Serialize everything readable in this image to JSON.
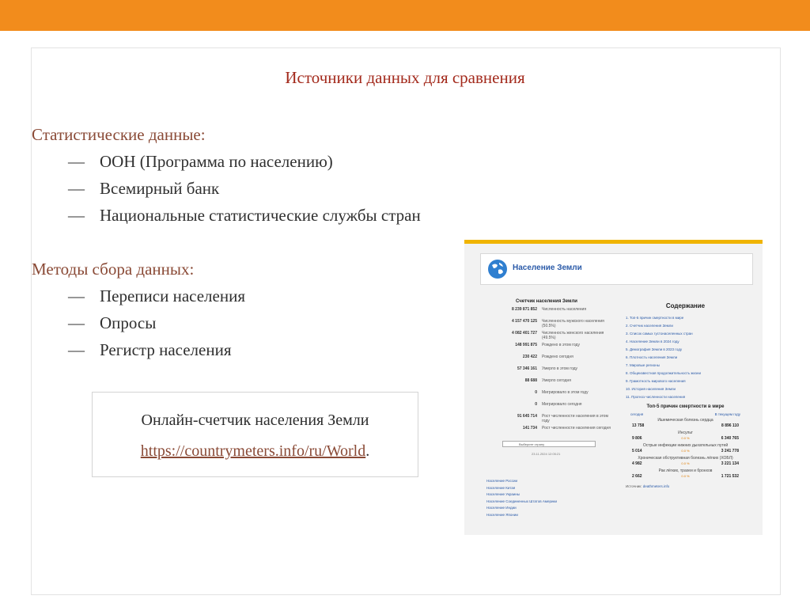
{
  "slide": {
    "title": "Источники данных для сравнения",
    "section1": {
      "heading": "Статистические данные:",
      "items": [
        "ООН (Программа по населению)",
        "Всемирный банк",
        "Национальные статистические службы стран"
      ]
    },
    "section2": {
      "heading": "Методы сбора данных:",
      "items": [
        "Переписи населения",
        "Опросы",
        "Регистр населения"
      ]
    },
    "dash": "—",
    "callout": {
      "text": "Онлайн-счетчик населения Земли",
      "link": "https://countrymeters.info/ru/World",
      "link_suffix": "."
    }
  },
  "screenshot": {
    "site_title": "Население Земли",
    "counter_heading": "Счетчик населения Земли",
    "counters": [
      {
        "value": "8 239 871 852",
        "label": "Численность населения"
      },
      {
        "value": "4 157 470 125",
        "label": "Численность мужского населения (50.5%)"
      },
      {
        "value": "4 082 401 727",
        "label": "Численность женского населения (49.5%)"
      },
      {
        "value": "148 991 875",
        "label": "Рождено в этом году"
      },
      {
        "value": "230 422",
        "label": "Рождено сегодня"
      },
      {
        "value": "57 346 161",
        "label": "Умерло в этом году"
      },
      {
        "value": "88 688",
        "label": "Умерло сегодня"
      },
      {
        "value": "0",
        "label": "Мигрировало в этом году"
      },
      {
        "value": "0",
        "label": "Мигрировало сегодня"
      },
      {
        "value": "91 645 714",
        "label": "Рост численности населения в этом году"
      },
      {
        "value": "141 734",
        "label": "Рост численности населения сегодня"
      }
    ],
    "select_label": "Выберите страну",
    "date": "23.11.2024 12:05:21",
    "country_links": [
      "Население России",
      "Население Китая",
      "Население Украины",
      "Население Соединенных Штатов Америки",
      "Население Индии",
      "Население Японии"
    ],
    "toc_heading": "Содержание",
    "toc": [
      "1. Топ-5 причин смертности в мире",
      "2. Счетчик населения Земли",
      "3. Список самых густонаселенных стран",
      "4. Население Земли в 2024 году",
      "5. Демография Земли в 2023 году",
      "6. Плотность населения Земли",
      "7. Мировые регионы",
      "8. Общеизвестная продолжительность жизни",
      "9. Грамотность мирового населения",
      "10. История населения Земли",
      "11. Прогноз численности населения"
    ],
    "causes_heading": "Топ-5 причин смертности в мире",
    "tab_today": "сегодня",
    "tab_year": "В текущем году",
    "causes": [
      {
        "name": "Ишемическая болезнь сердца",
        "today": "13 758",
        "mid": "",
        "year": "8 896 110"
      },
      {
        "name": "Инсульт",
        "today": "9 806",
        "mid": "0.0 %",
        "year": "6 340 765"
      },
      {
        "name": "Острые инфекции нижних дыхательных путей",
        "today": "5 014",
        "mid": "0.0 %",
        "year": "3 241 778"
      },
      {
        "name": "Хроническая обструктивная болезнь лёгких (ХОБЛ)",
        "today": "4 982",
        "mid": "0.0 %",
        "year": "3 221 134"
      },
      {
        "name": "Рак лёгких, трахеи и бронхов",
        "today": "2 662",
        "mid": "0.0 %",
        "year": "1 721 532"
      }
    ],
    "source_label": "Источник:",
    "source_link": "deathmeters.info"
  },
  "colors": {
    "accent": "#f28c1c",
    "title": "#a32a1c",
    "heading": "#8a4a36"
  }
}
